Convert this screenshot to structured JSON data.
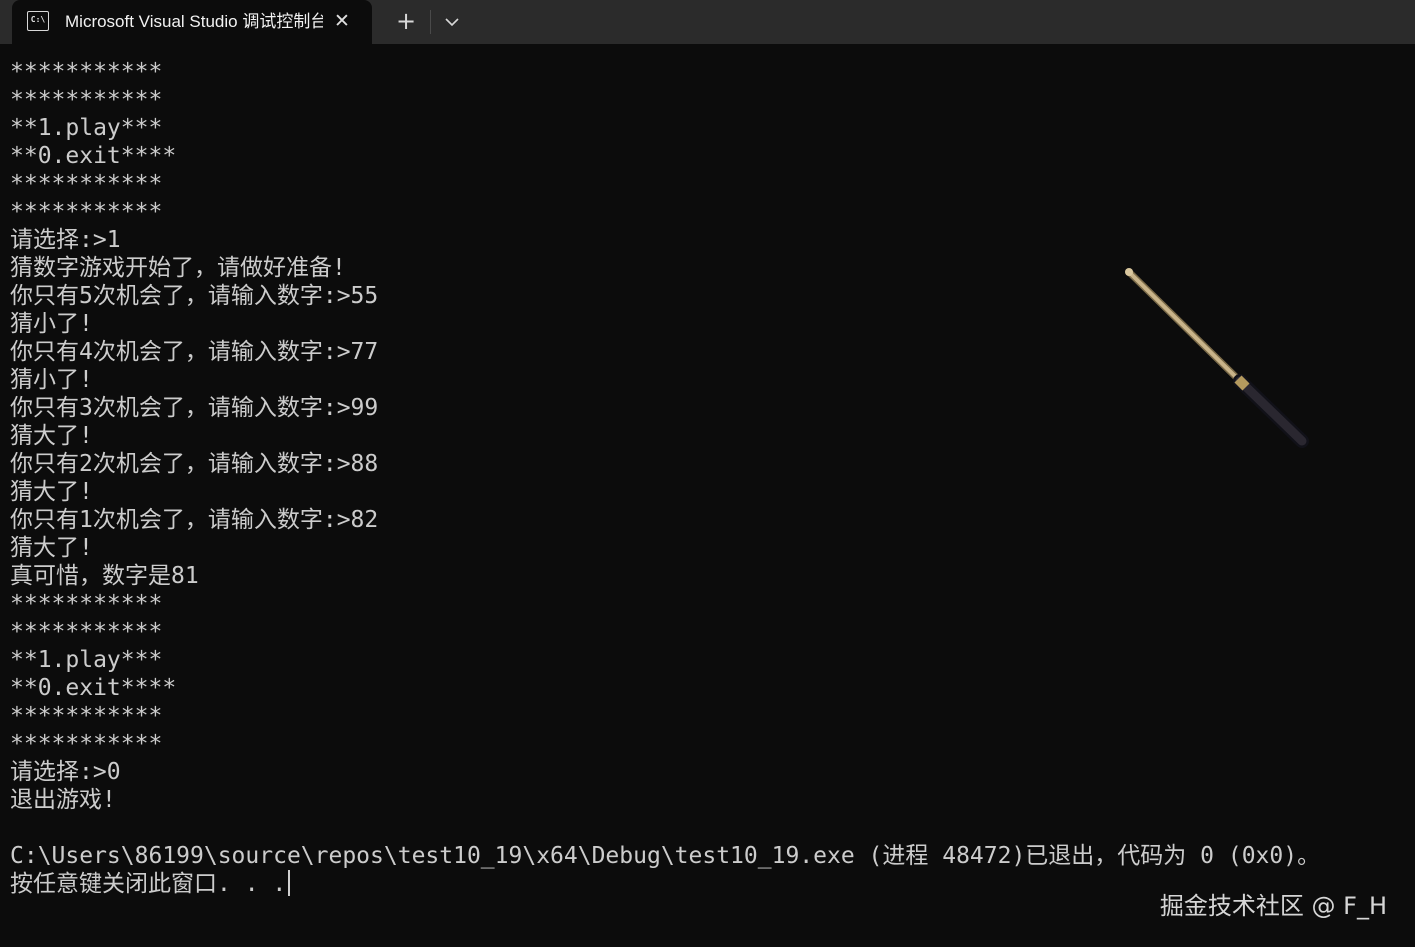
{
  "window": {
    "tab_title": "Microsoft Visual Studio 调试控制台",
    "tab_icon_text": "C:\\",
    "close_glyph": "✕",
    "new_tab_glyph": "+"
  },
  "console": {
    "lines": [
      "***********",
      "***********",
      "**1.play***",
      "**0.exit****",
      "***********",
      "***********",
      "请选择:>1",
      "猜数字游戏开始了，请做好准备!",
      "你只有5次机会了，请输入数字:>55",
      "猜小了!",
      "你只有4次机会了，请输入数字:>77",
      "猜小了!",
      "你只有3次机会了，请输入数字:>99",
      "猜大了!",
      "你只有2次机会了，请输入数字:>88",
      "猜大了!",
      "你只有1次机会了，请输入数字:>82",
      "猜大了!",
      "真可惜，数字是81",
      "***********",
      "***********",
      "**1.play***",
      "**0.exit****",
      "***********",
      "***********",
      "请选择:>0",
      "退出游戏!",
      "",
      "C:\\Users\\86199\\source\\repos\\test10_19\\x64\\Debug\\test10_19.exe (进程 48472)已退出，代码为 0 (0x0)。",
      "按任意键关闭此窗口. . ."
    ]
  },
  "watermark": "掘金技术社区 @ F_H",
  "colors": {
    "background": "#0c0c0c",
    "tabbar": "#2b2b2b",
    "text": "#cccccc"
  }
}
